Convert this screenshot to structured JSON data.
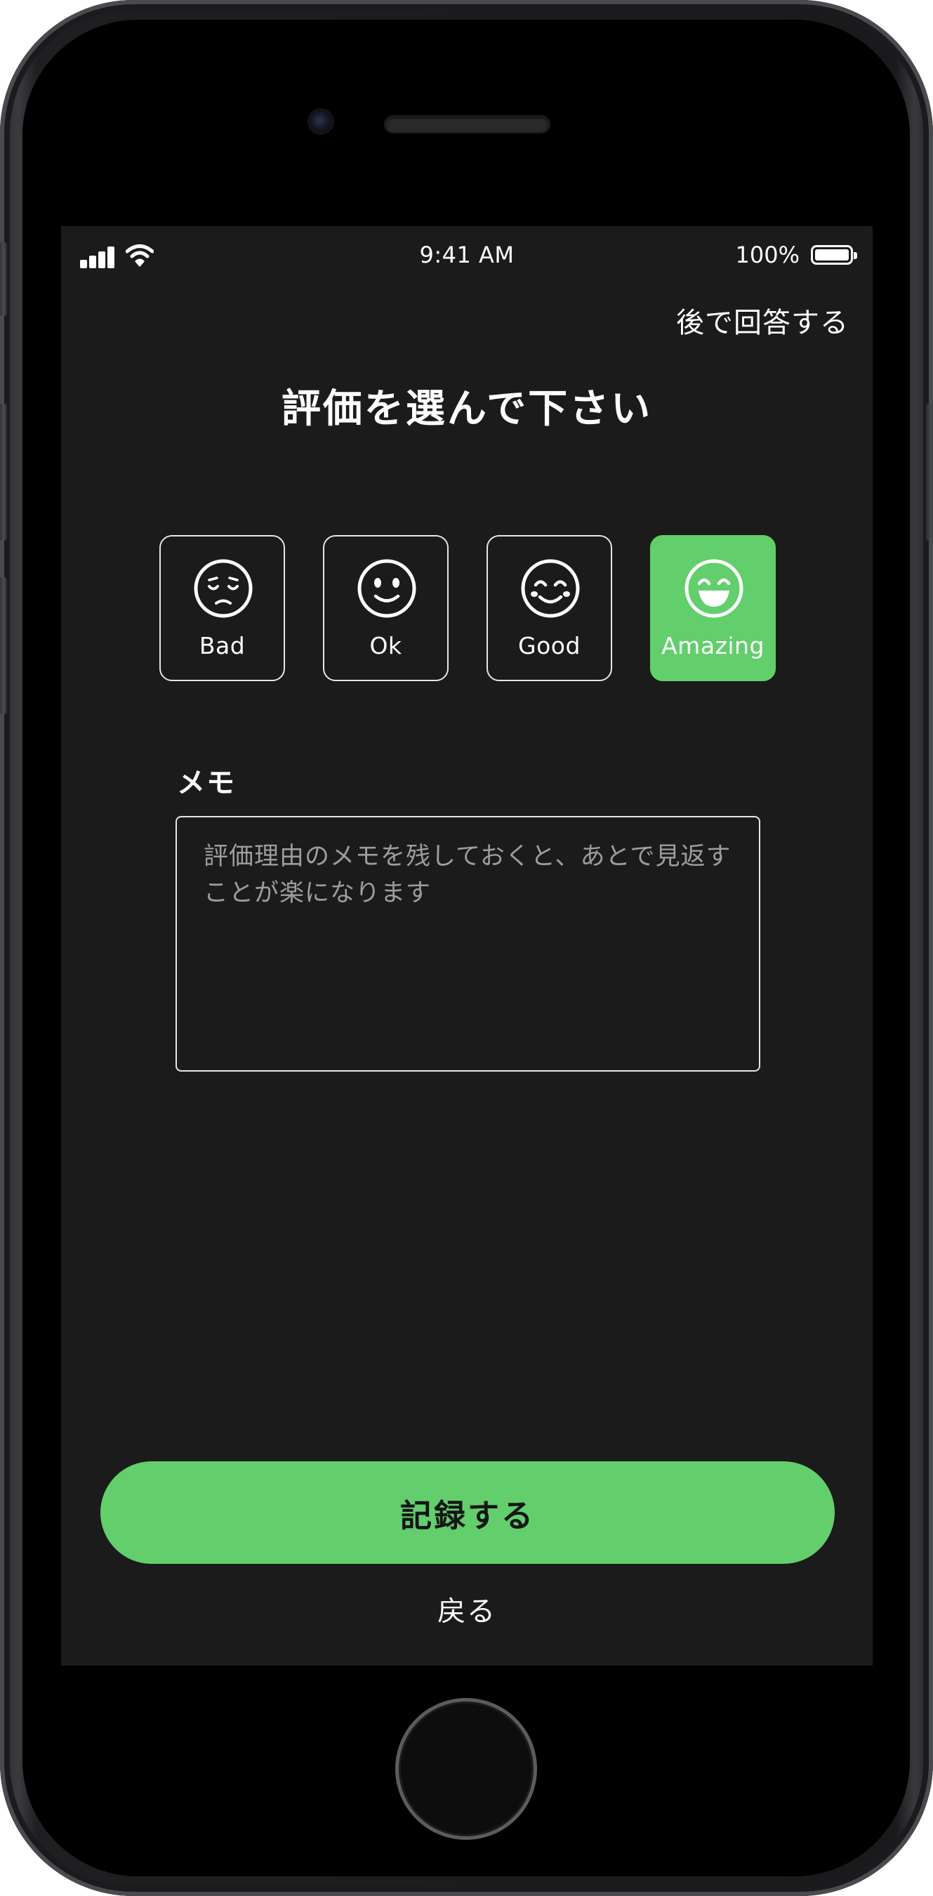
{
  "status_bar": {
    "time": "9:41 AM",
    "battery_percent": "100%",
    "icons": [
      "cellular-signal-icon",
      "wifi-icon",
      "battery-icon"
    ]
  },
  "header": {
    "skip_label": "後で回答する",
    "title": "評価を選んで下さい"
  },
  "ratings": {
    "selected": "Amazing",
    "items": [
      {
        "label": "Bad",
        "icon": "sad-face-icon"
      },
      {
        "label": "Ok",
        "icon": "neutral-smile-face-icon"
      },
      {
        "label": "Good",
        "icon": "happy-face-icon"
      },
      {
        "label": "Amazing",
        "icon": "grinning-face-icon"
      }
    ]
  },
  "memo": {
    "label": "メモ",
    "value": "",
    "placeholder": "評価理由のメモを残しておくと、あとで見返すことが楽になります"
  },
  "actions": {
    "submit_label": "記録する",
    "back_label": "戻る"
  },
  "colors": {
    "accent": "#62cf6c",
    "screen_background": "#1b1b1b",
    "text": "#ffffff",
    "placeholder": "#9d9d9d",
    "border": "#e6e6e6"
  }
}
